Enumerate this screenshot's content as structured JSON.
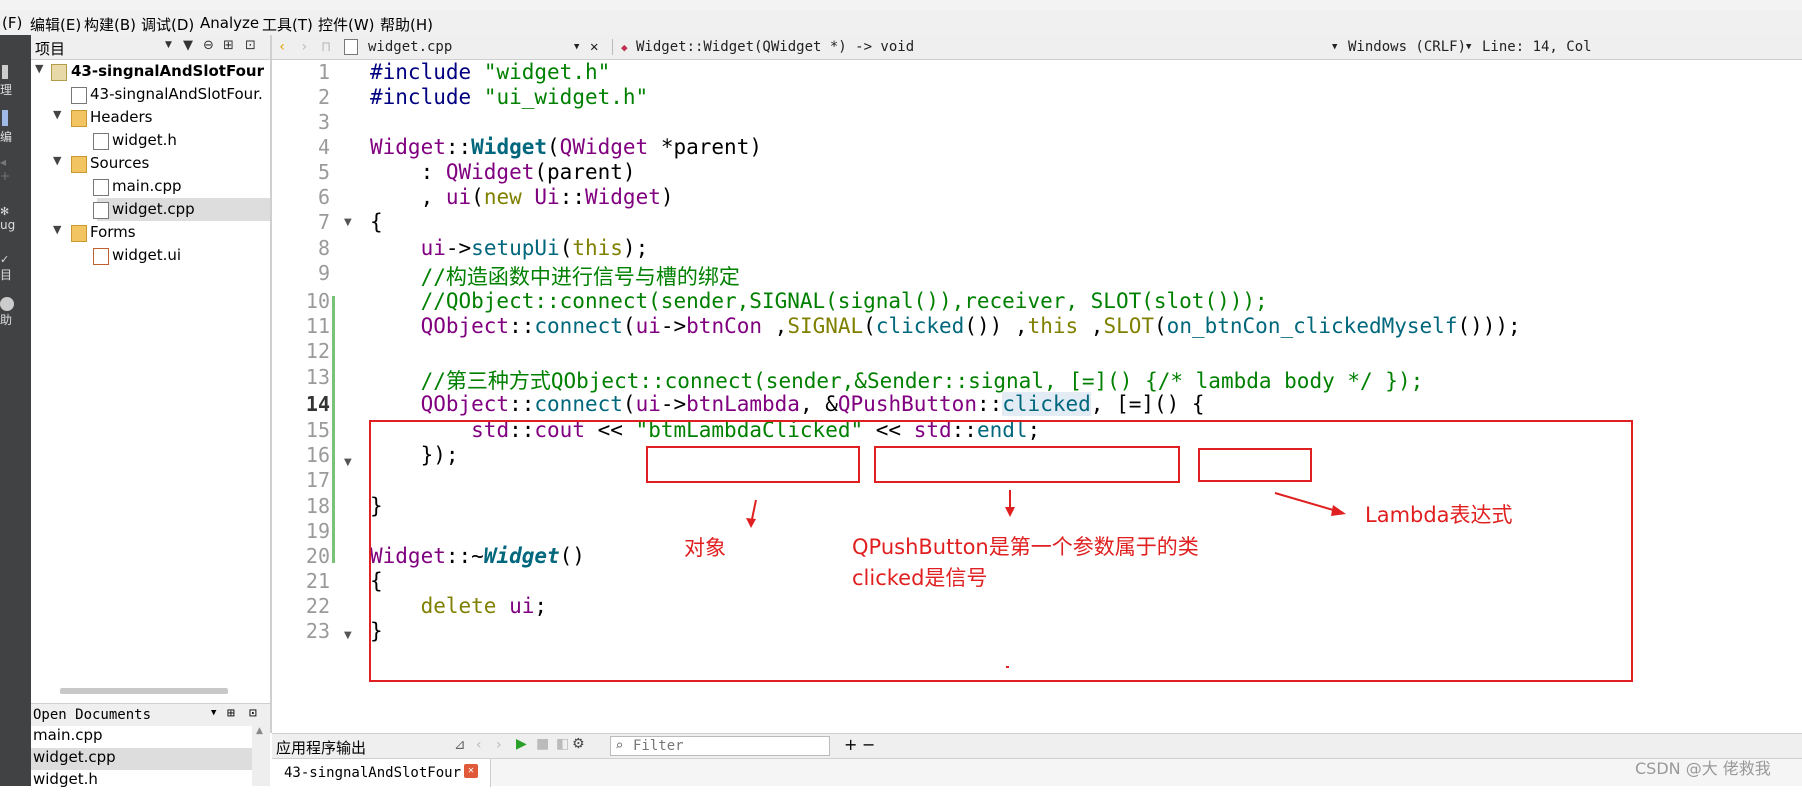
{
  "menu": [
    "(F)",
    "编辑(E)",
    "构建(B)",
    "调试(D)",
    "Analyze",
    "工具(T)",
    "控件(W)",
    "帮助(H)"
  ],
  "modes": [
    "理",
    "编",
    "ug",
    "目",
    "助"
  ],
  "project_panel": {
    "title": "项目",
    "tree": [
      {
        "label": "43-singnalAndSlotFour",
        "bold": true,
        "arrow": "▼",
        "icon": "project"
      },
      {
        "label": "43-singnalAndSlotFour.",
        "arrow": "",
        "icon": "profile"
      },
      {
        "label": "Headers",
        "arrow": "▼",
        "icon": "folder-h"
      },
      {
        "label": "widget.h",
        "arrow": "",
        "icon": "file"
      },
      {
        "label": "Sources",
        "arrow": "▼",
        "icon": "folder-cpp"
      },
      {
        "label": "main.cpp",
        "arrow": "",
        "icon": "file"
      },
      {
        "label": "widget.cpp",
        "arrow": "",
        "icon": "file",
        "selected": true
      },
      {
        "label": "Forms",
        "arrow": "▼",
        "icon": "folder-ui"
      },
      {
        "label": "widget.ui",
        "arrow": "",
        "icon": "ui-file"
      }
    ]
  },
  "open_documents": {
    "title": "Open Documents",
    "items": [
      "main.cpp",
      "widget.cpp",
      "widget.h"
    ],
    "selected_index": 1
  },
  "editor_toolbar": {
    "file": "widget.cpp",
    "symbol": "Widget::Widget(QWidget *) -> void",
    "line_ending": "Windows (CRLF)",
    "position": "Line: 14, Col"
  },
  "line_numbers": [
    "1",
    "2",
    "3",
    "4",
    "5",
    "6",
    "7",
    "8",
    "9",
    "10",
    "11",
    "12",
    "13",
    "14",
    "15",
    "16",
    "17",
    "18",
    "19",
    "20",
    "21",
    "22",
    "23"
  ],
  "current_line": "14",
  "annotations": {
    "object": "对象",
    "class_line1": "QPushButton是第一个参数属于的类",
    "class_line2": "clicked是信号",
    "lambda": "Lambda表达式"
  },
  "bottom_panel": {
    "title": "应用程序输出",
    "filter_placeholder": "Filter",
    "tab": "43-singnalAndSlotFour"
  },
  "watermark": "CSDN @大 佬救我",
  "colors": {
    "keyword": "#808000",
    "type": "#800080",
    "string": "#008000",
    "function": "#00677c",
    "annotation": "#e02020"
  }
}
